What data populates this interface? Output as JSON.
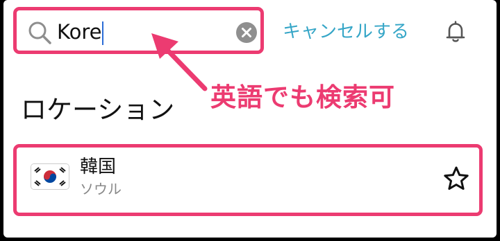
{
  "search": {
    "value": "Kore",
    "cancel_label": "キャンセルする"
  },
  "annotation": {
    "text": "英語でも検索可",
    "color": "#ec3b71"
  },
  "section": {
    "title": "ロケーション"
  },
  "results": [
    {
      "name": "韓国",
      "subtitle": "ソウル",
      "flag": "south-korea-flag-icon",
      "favorite_icon": "star-icon"
    }
  ],
  "icons": {
    "search": "search-icon",
    "clear": "clear-icon",
    "notifications": "bell-icon"
  },
  "colors": {
    "accent": "#36a6c7",
    "highlight": "#ec3b71"
  }
}
